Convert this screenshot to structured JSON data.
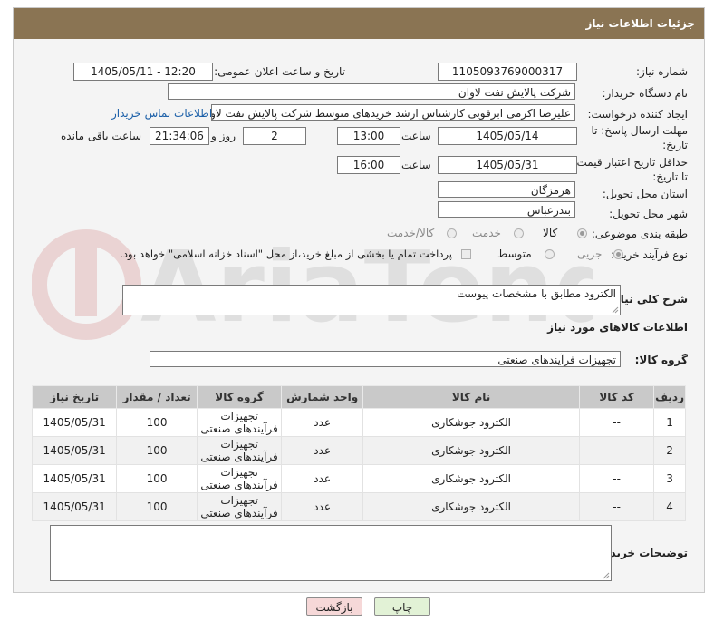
{
  "header": {
    "title": "جزئیات اطلاعات نیاز"
  },
  "fields": {
    "need_number_label": "شماره نیاز:",
    "need_number": "1105093769000317",
    "announce_label": "تاریخ و ساعت اعلان عمومی:",
    "announce_value": "1405/05/11 - 12:20",
    "buyer_org_label": "نام دستگاه خریدار:",
    "buyer_org": "شرکت پالایش نفت لاوان",
    "requester_label": "ایجاد کننده درخواست:",
    "requester": "علیرضا اکرمی ابرقویی کارشناس ارشد خریدهای متوسط شرکت پالایش نفت لاو",
    "contact_link": "اطلاعات تماس خریدار",
    "deadline_label_1": "مهلت ارسال پاسخ: تا",
    "deadline_label_2": "تاریخ:",
    "deadline_date": "1405/05/14",
    "time_label": "ساعت",
    "deadline_time": "13:00",
    "days_value": "2",
    "days_label": "روز و",
    "remaining_time": "21:34:06",
    "remaining_label": "ساعت باقی مانده",
    "validity_label_1": "حداقل تاریخ اعتبار قیمت:",
    "validity_label_2": "تا تاریخ:",
    "validity_date": "1405/05/31",
    "validity_time": "16:00",
    "province_label": "استان محل تحویل:",
    "province": "هرمزگان",
    "city_label": "شهر محل تحویل:",
    "city": "بندرعباس",
    "category_label": "طبقه بندی موضوعی:",
    "category_options": [
      "کالا",
      "خدمت",
      "کالا/خدمت"
    ],
    "process_label": "نوع فرآیند خرید :",
    "process_options": [
      "جزیی",
      "متوسط"
    ],
    "payment_note": "پرداخت تمام یا بخشی از مبلغ خرید،از محل \"اسناد خزانه اسلامی\" خواهد بود."
  },
  "description": {
    "label": "شرح کلی نیاز:",
    "value": "الکترود مطابق با مشخصات پیوست"
  },
  "goods_section": {
    "title": "اطلاعات کالاهای مورد نیاز"
  },
  "goods_group": {
    "label": "گروه کالا:",
    "value": "تجهیزات فرآیندهای صنعتی"
  },
  "table": {
    "headers": [
      "ردیف",
      "کد کالا",
      "نام کالا",
      "واحد شمارش",
      "گروه کالا",
      "تعداد / مقدار",
      "تاریخ نیاز"
    ],
    "rows": [
      [
        "1",
        "--",
        "الکترود جوشکاری",
        "عدد",
        "تجهیزات فرآیندهای صنعتی",
        "100",
        "1405/05/31"
      ],
      [
        "2",
        "--",
        "الکترود جوشکاری",
        "عدد",
        "تجهیزات فرآیندهای صنعتی",
        "100",
        "1405/05/31"
      ],
      [
        "3",
        "--",
        "الکترود جوشکاری",
        "عدد",
        "تجهیزات فرآیندهای صنعتی",
        "100",
        "1405/05/31"
      ],
      [
        "4",
        "--",
        "الکترود جوشکاری",
        "عدد",
        "تجهیزات فرآیندهای صنعتی",
        "100",
        "1405/05/31"
      ]
    ]
  },
  "buyer_notes": {
    "label": "توضیحات خریدار:",
    "value": ""
  },
  "buttons": {
    "print": "چاپ",
    "back": "بازگشت"
  },
  "colors": {
    "header_bg": "#8a7453",
    "table_header_bg": "#c9c9c9",
    "back_button_bg": "#f6d8d8",
    "print_button_bg": "#e2f2d6"
  }
}
